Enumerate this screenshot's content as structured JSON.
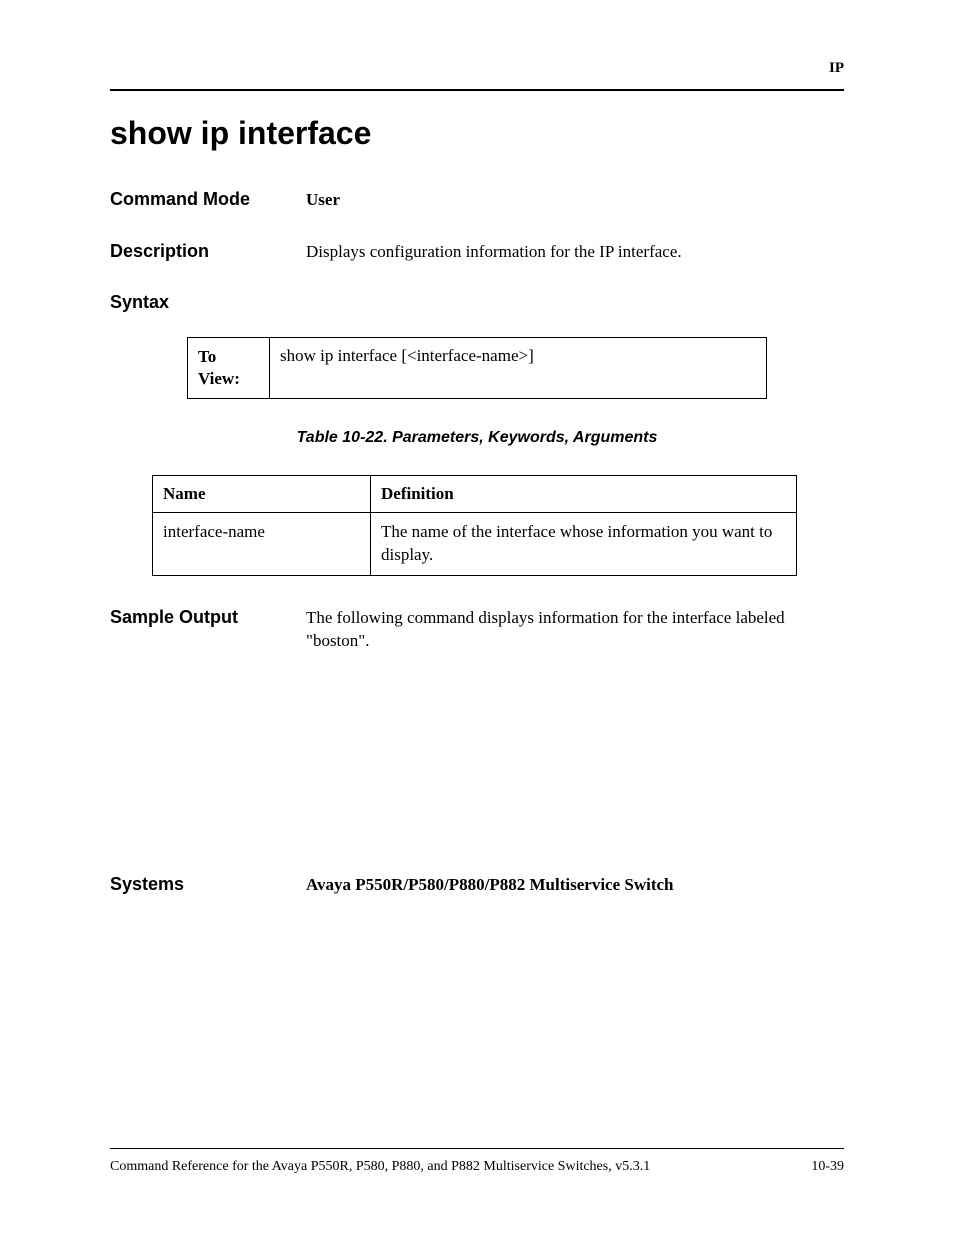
{
  "header": {
    "category": "IP"
  },
  "title": "show ip interface",
  "commandMode": {
    "label": "Command Mode",
    "value": "User"
  },
  "description": {
    "label": "Description",
    "value": "Displays configuration information for the IP interface."
  },
  "syntax": {
    "label": "Syntax",
    "toViewLabel": "To View:",
    "command": "show ip interface [<interface-name>]"
  },
  "paramsTable": {
    "caption": "Table 10-22.  Parameters, Keywords, Arguments",
    "headers": {
      "name": "Name",
      "definition": "Definition"
    },
    "rows": [
      {
        "name": "interface-name",
        "definition": "The name of the interface whose information you want to display."
      }
    ]
  },
  "sampleOutput": {
    "label": "Sample Output",
    "value": "The following command displays information for the interface labeled \"boston\"."
  },
  "systems": {
    "label": "Systems",
    "value": "Avaya P550R/P580/P880/P882 Multiservice Switch"
  },
  "footer": {
    "docTitle": "Command Reference for the Avaya P550R, P580, P880, and P882 Multiservice Switches, v5.3.1",
    "pageNumber": "10-39"
  }
}
